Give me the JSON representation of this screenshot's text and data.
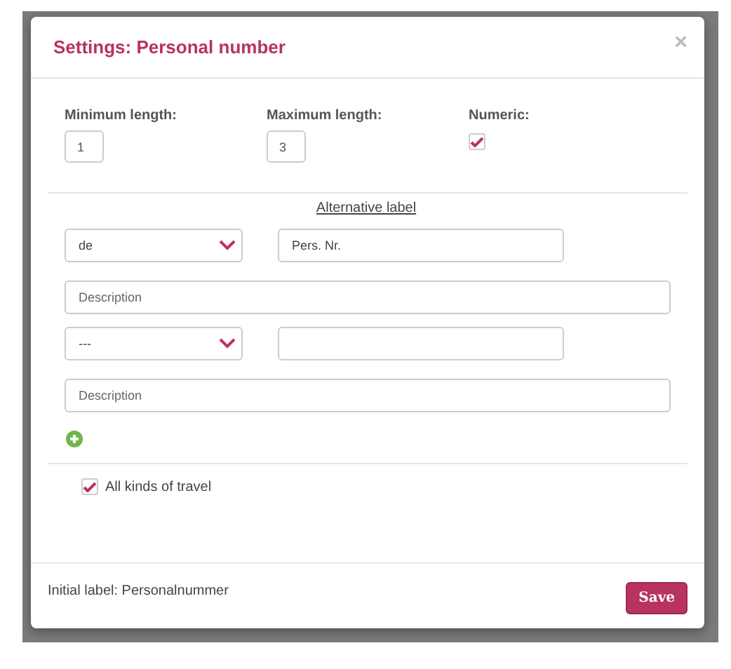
{
  "dialog": {
    "title": "Settings: Personal number",
    "close": "×"
  },
  "fields": [
    {
      "label": "Minimum length:",
      "kind": "number",
      "value": "1"
    },
    {
      "label": "Maximum length:",
      "kind": "number",
      "value": "3"
    },
    {
      "label": "Numeric:",
      "kind": "checkbox",
      "checked": true
    }
  ],
  "alternative_label": {
    "heading": "Alternative label",
    "entries": [
      {
        "language": "de",
        "label": "Pers. Nr.",
        "description_placeholder": "Description"
      },
      {
        "language": "---",
        "description_placeholder": "Description"
      }
    ]
  },
  "all_kinds_of_travel": {
    "label": "All kinds of travel",
    "checked": true
  },
  "footer": {
    "initial_label": "Initial label: Personalnummer",
    "save": "Save"
  }
}
